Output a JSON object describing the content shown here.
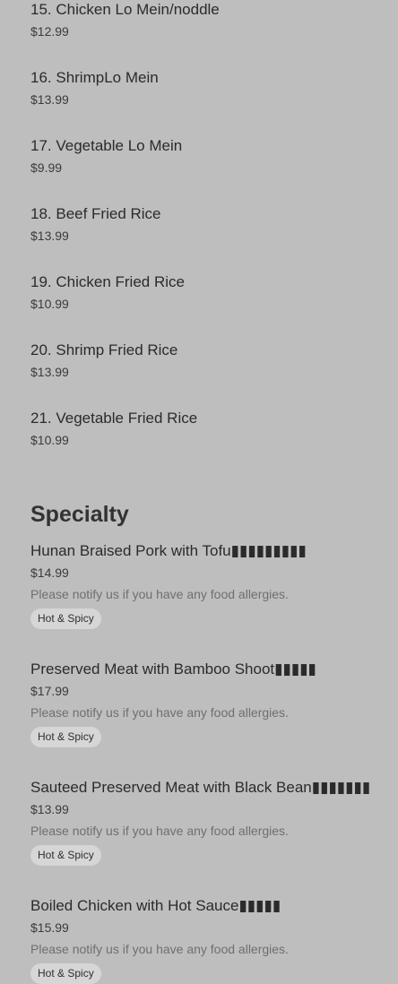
{
  "simple_items": [
    {
      "name": "15. Chicken Lo Mein/noddle",
      "price": "$12.99"
    },
    {
      "name": "16. ShrimpLo Mein",
      "price": "$13.99"
    },
    {
      "name": "17. Vegetable Lo Mein",
      "price": "$9.99"
    },
    {
      "name": "18. Beef Fried Rice",
      "price": "$13.99"
    },
    {
      "name": "19. Chicken Fried Rice",
      "price": "$10.99"
    },
    {
      "name": "20. Shrimp Fried Rice",
      "price": "$13.99"
    },
    {
      "name": "21. Vegetable Fried Rice",
      "price": "$10.99"
    }
  ],
  "specialty": {
    "title": "Specialty",
    "items": [
      {
        "name": "Hunan Braised Pork with Tofu▮▮▮▮▮▮▮▮▮",
        "price": "$14.99",
        "note": "Please notify us if you have any food allergies.",
        "tag": "Hot & Spicy"
      },
      {
        "name": "Preserved Meat with Bamboo Shoot▮▮▮▮▮",
        "price": "$17.99",
        "note": "Please notify us if you have any food allergies.",
        "tag": "Hot & Spicy"
      },
      {
        "name": "Sauteed Preserved Meat with Black Bean▮▮▮▮▮▮▮",
        "price": "$13.99",
        "note": "Please notify us if you have any food allergies.",
        "tag": "Hot & Spicy"
      },
      {
        "name": "Boiled Chicken with Hot Sauce▮▮▮▮▮",
        "price": "$15.99",
        "note": "Please notify us if you have any food allergies.",
        "tag": "Hot & Spicy"
      }
    ]
  }
}
